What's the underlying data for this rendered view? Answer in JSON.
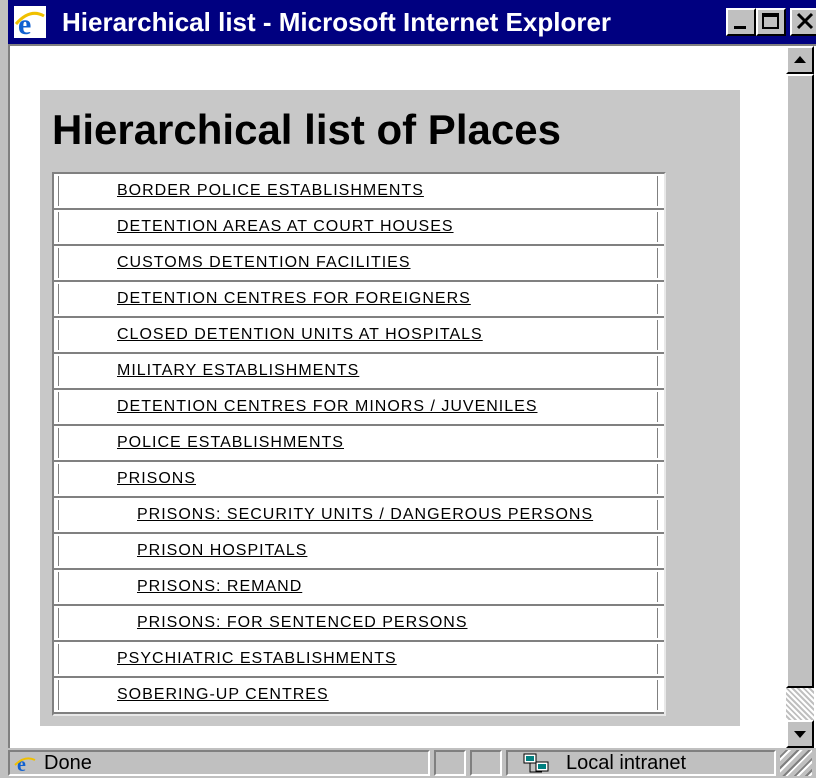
{
  "window": {
    "title": "Hierarchical list - Microsoft Internet Explorer",
    "title_icon": "ie-icon",
    "controls": [
      "minimize",
      "maximize",
      "close"
    ],
    "colors": {
      "titlebar": "#000080",
      "panel": "#c8c8c8",
      "chrome": "#c0c0c0"
    }
  },
  "page": {
    "heading": "Hierarchical list of Places",
    "items": [
      {
        "label": "BORDER POLICE ESTABLISHMENTS",
        "level": 1
      },
      {
        "label": "DETENTION AREAS AT COURT HOUSES",
        "level": 1
      },
      {
        "label": "CUSTOMS DETENTION FACILITIES",
        "level": 1
      },
      {
        "label": "DETENTION CENTRES FOR FOREIGNERS",
        "level": 1
      },
      {
        "label": "CLOSED DETENTION UNITS AT HOSPITALS",
        "level": 1
      },
      {
        "label": "MILITARY ESTABLISHMENTS",
        "level": 1
      },
      {
        "label": "DETENTION CENTRES FOR MINORS / JUVENILES",
        "level": 1
      },
      {
        "label": "POLICE ESTABLISHMENTS",
        "level": 1
      },
      {
        "label": "PRISONS",
        "level": 1
      },
      {
        "label": "PRISONS: SECURITY UNITS / DANGEROUS PERSONS",
        "level": 2
      },
      {
        "label": "PRISON HOSPITALS",
        "level": 2
      },
      {
        "label": "PRISONS: REMAND",
        "level": 2
      },
      {
        "label": "PRISONS: FOR SENTENCED PERSONS",
        "level": 2
      },
      {
        "label": "PSYCHIATRIC ESTABLISHMENTS",
        "level": 1
      },
      {
        "label": "SOBERING-UP CENTRES",
        "level": 1
      }
    ]
  },
  "status": {
    "text": "Done",
    "zone": "Local intranet"
  }
}
